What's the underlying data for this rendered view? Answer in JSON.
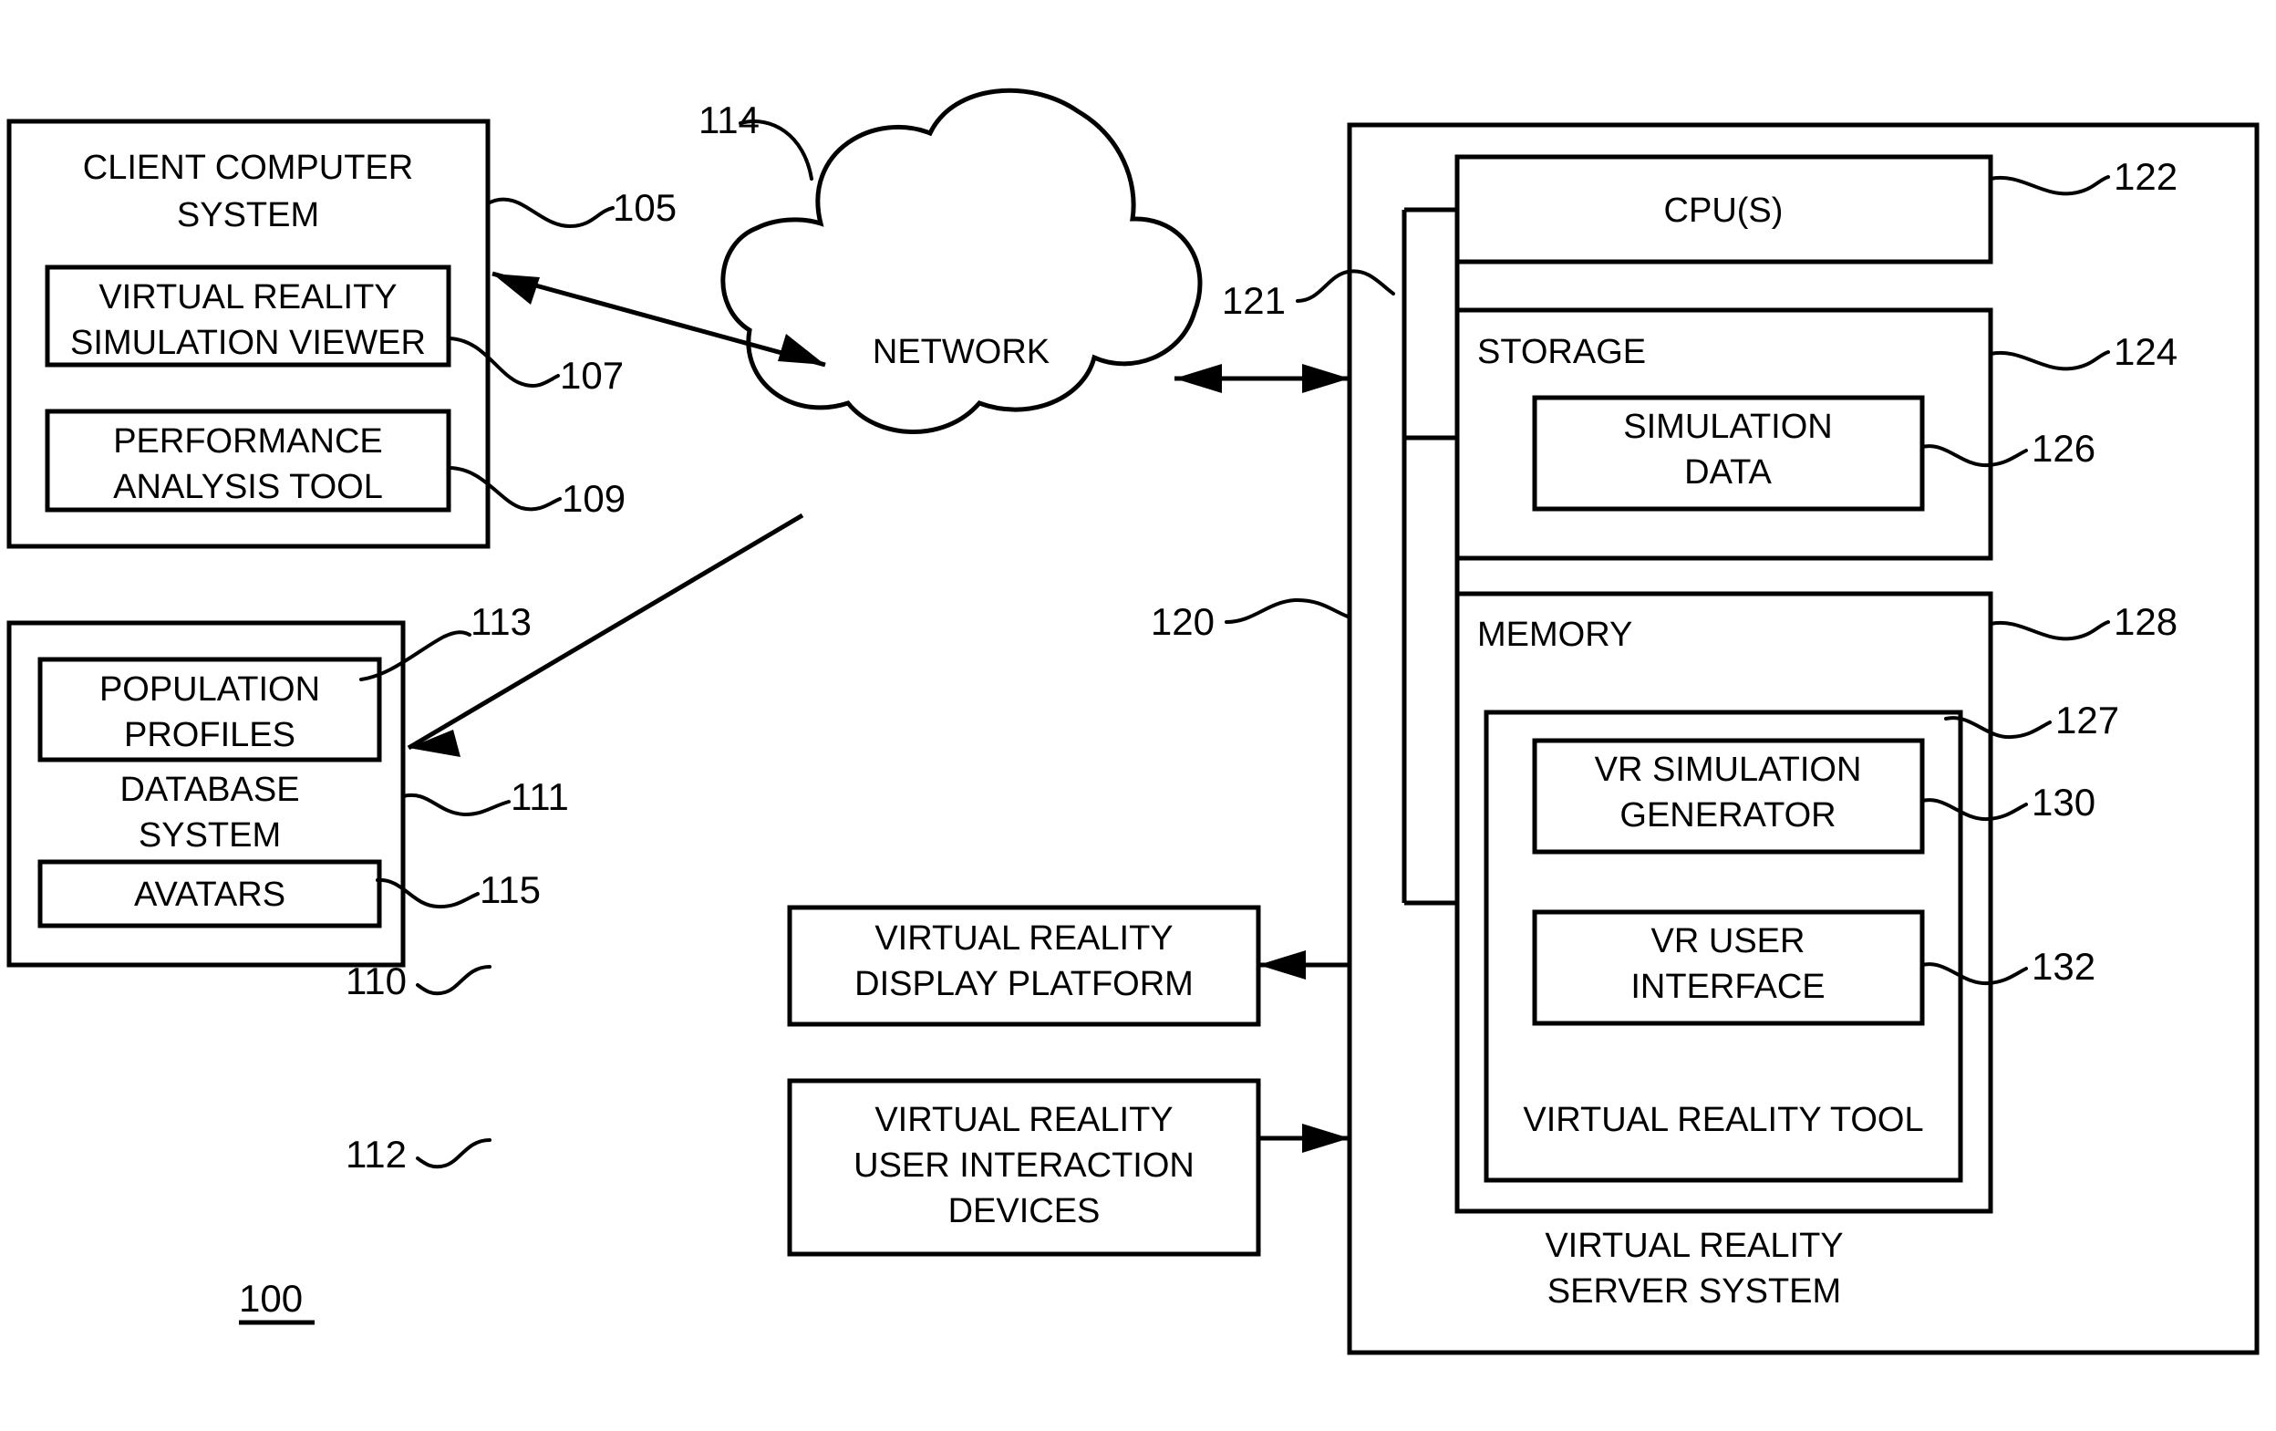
{
  "figure": {
    "number": "100",
    "type": "patent-block-diagram"
  },
  "blocks": {
    "client_computer_system": {
      "title_line1": "CLIENT COMPUTER",
      "title_line2": "SYSTEM",
      "ref": "105",
      "children": {
        "vr_simulation_viewer": {
          "line1": "VIRTUAL REALITY",
          "line2": "SIMULATION VIEWER",
          "ref": "107"
        },
        "performance_analysis_tool": {
          "line1": "PERFORMANCE",
          "line2": "ANALYSIS TOOL",
          "ref": "109"
        }
      }
    },
    "database_system": {
      "title_line1": "DATABASE",
      "title_line2": "SYSTEM",
      "ref": "111",
      "children": {
        "population_profiles": {
          "line1": "POPULATION",
          "line2": "PROFILES",
          "ref": "113"
        },
        "avatars": {
          "line1": "AVATARS",
          "ref": "115"
        }
      }
    },
    "network": {
      "label": "NETWORK",
      "ref": "114"
    },
    "vr_display_platform": {
      "line1": "VIRTUAL REALITY",
      "line2": "DISPLAY PLATFORM",
      "ref": "110"
    },
    "vr_user_interaction_devices": {
      "line1": "VIRTUAL REALITY",
      "line2": "USER INTERACTION",
      "line3": "DEVICES",
      "ref": "112"
    },
    "vr_server_system": {
      "title_line1": "VIRTUAL REALITY",
      "title_line2": "SERVER SYSTEM",
      "ref": "120",
      "bus_ref": "121",
      "children": {
        "cpus": {
          "label": "CPU(S)",
          "ref": "122"
        },
        "storage": {
          "label": "STORAGE",
          "ref": "124",
          "children": {
            "simulation_data": {
              "line1": "SIMULATION",
              "line2": "DATA",
              "ref": "126"
            }
          }
        },
        "memory": {
          "label": "MEMORY",
          "ref": "128",
          "children": {
            "virtual_reality_tool": {
              "label": "VIRTUAL REALITY TOOL",
              "ref": "127",
              "children": {
                "vr_simulation_generator": {
                  "line1": "VR SIMULATION",
                  "line2": "GENERATOR",
                  "ref": "130"
                },
                "vr_user_interface": {
                  "line1": "VR USER",
                  "line2": "INTERFACE",
                  "ref": "132"
                }
              }
            }
          }
        }
      }
    }
  },
  "colors": {
    "ink": "#000000",
    "paper": "#ffffff"
  }
}
